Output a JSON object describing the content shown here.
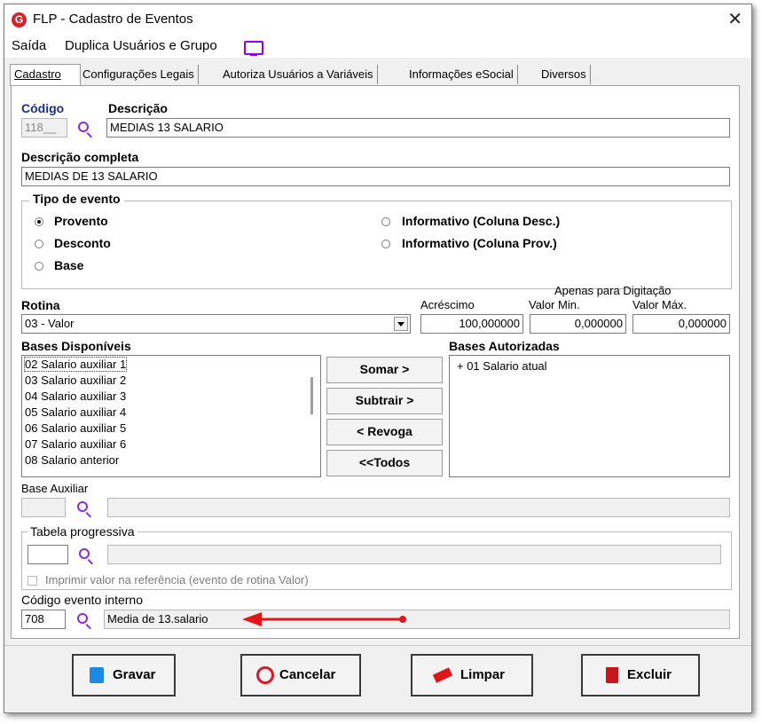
{
  "window": {
    "title": "FLP - Cadastro de Eventos"
  },
  "menu": {
    "saida": "Saída",
    "duplica": "Duplica Usuários e Grupo"
  },
  "tabs": [
    {
      "label": "Cadastro"
    },
    {
      "label": "Configurações Legais"
    },
    {
      "label": "Autoriza Usuários a Variáveis"
    },
    {
      "label": "Informações eSocial"
    },
    {
      "label": "Diversos"
    }
  ],
  "form": {
    "codigo_label": "Código",
    "codigo_value": "118__",
    "descricao_label": "Descrição",
    "descricao_value": "MEDIAS 13 SALARIO",
    "desc_completa_label": "Descrição completa",
    "desc_completa_value": "MEDIAS DE 13 SALARIO",
    "tipo_evento": {
      "title": "Tipo de evento",
      "options": [
        "Provento",
        "Desconto",
        "Base",
        "Informativo (Coluna Desc.)",
        "Informativo (Coluna Prov.)"
      ],
      "selected": "Provento"
    },
    "rotina_label": "Rotina",
    "rotina_value": "03 - Valor",
    "acrescimo_label": "Acréscimo",
    "acrescimo_value": "100,000000",
    "apenas_label": "Apenas para Digitação",
    "valor_min_label": "Valor Min.",
    "valor_min_value": "0,000000",
    "valor_max_label": "Valor Máx.",
    "valor_max_value": "0,000000",
    "bases_disponiveis_label": "Bases Disponíveis",
    "bases_disponiveis": [
      "02 Salario auxiliar 1",
      "03 Salario auxiliar 2",
      "04 Salario auxiliar 3",
      "05 Salario auxiliar 4",
      "06 Salario auxiliar 5",
      "07 Salario auxiliar 6",
      "08 Salario anterior"
    ],
    "bases_autorizadas_label": "Bases Autorizadas",
    "bases_autorizadas": [
      "+ 01 Salario atual"
    ],
    "somar_btn": "Somar >",
    "subtrair_btn": "Subtrair >",
    "revoga_btn": "< Revoga",
    "todos_btn": "<<Todos",
    "base_auxiliar_label": "Base Auxiliar",
    "tabela_progressiva_label": "Tabela progressiva",
    "imprimir_label": "Imprimir valor na referência (evento de rotina Valor)",
    "codigo_interno_label": "Código evento interno",
    "codigo_interno_value": "708",
    "codigo_interno_desc": "Media de 13.salario"
  },
  "footer": {
    "gravar": "Gravar",
    "cancelar": "Cancelar",
    "limpar": "Limpar",
    "excluir": "Excluir"
  },
  "colors": {
    "accent": "#8a2be2",
    "arrow": "#e0161b",
    "gravar_icon": "#1e88e5",
    "cancelar_icon": "#d81b2a",
    "excluir_icon": "#c4161c"
  }
}
